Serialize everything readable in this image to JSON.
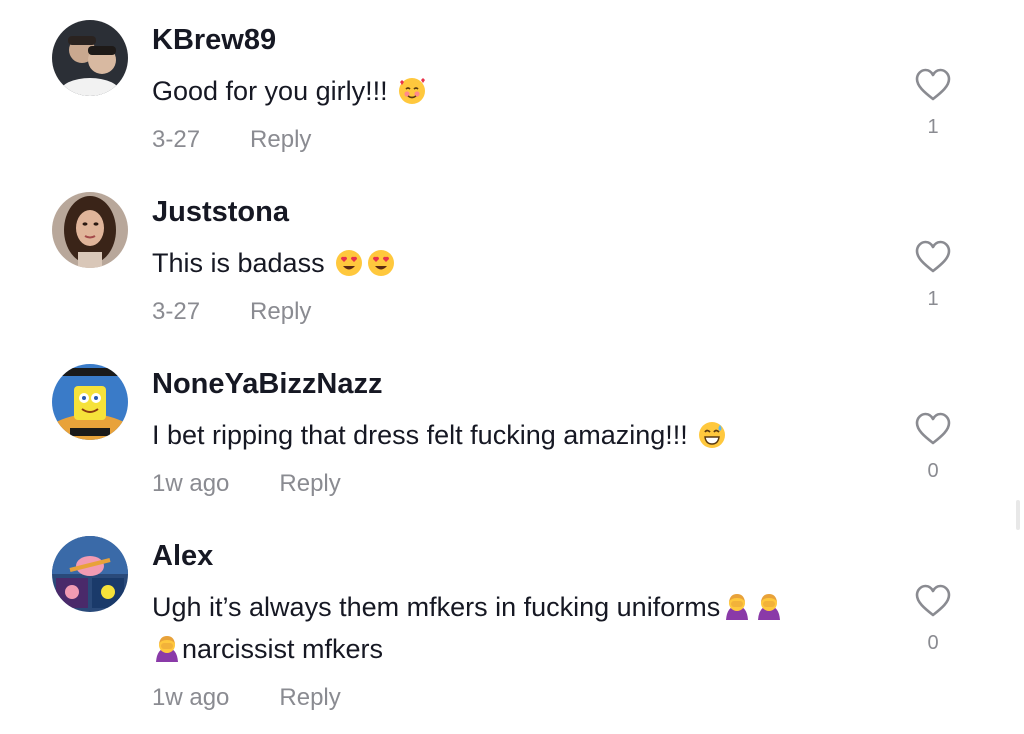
{
  "comments": [
    {
      "username": "KBrew89",
      "text_lines": [
        "Good for you girly!!!"
      ],
      "emoji": "smiling-face-with-hearts-emoji",
      "date": "3-27",
      "reply_label": "Reply",
      "likes": "1"
    },
    {
      "username": "Juststona",
      "text_lines": [
        "This is badass"
      ],
      "emoji": "heart-eyes-emoji",
      "date": "3-27",
      "reply_label": "Reply",
      "likes": "1"
    },
    {
      "username": "NoneYaBizzNazz",
      "text_lines": [
        "I bet ripping that dress felt fucking amazing!!!"
      ],
      "emoji": "grinning-sweat-emoji",
      "date": "1w ago",
      "reply_label": "Reply",
      "likes": "0"
    },
    {
      "username": "Alex",
      "text_lines": [
        "Ugh it’s always them mfkers in fucking uniforms",
        "narcissist mfkers"
      ],
      "emoji": "facepalm-woman-emoji",
      "date": "1w ago",
      "reply_label": "Reply",
      "likes": "0"
    }
  ],
  "colors": {
    "text": "#161823",
    "secondary": "#8a8b91",
    "heart_outline": "#8a8b91"
  }
}
